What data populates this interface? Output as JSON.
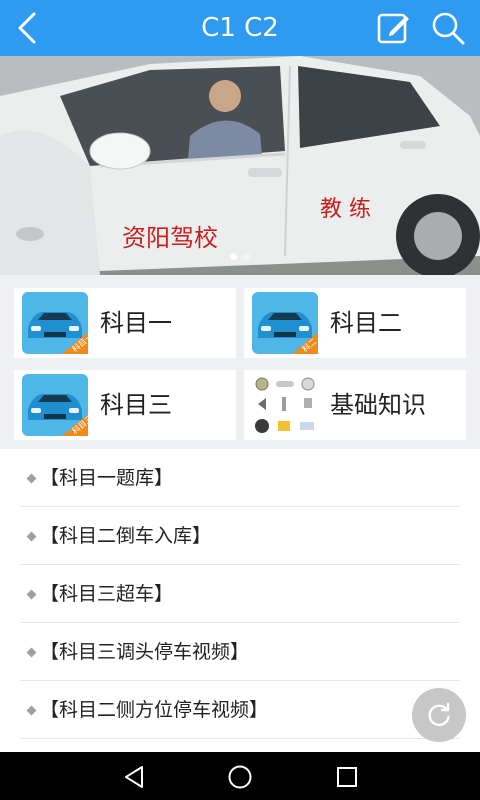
{
  "colors": {
    "accent": "#2f9bf0",
    "banner_text": "#c81e1e"
  },
  "header": {
    "title": "C1 C2",
    "icons": {
      "back": "chevron-left-icon",
      "edit": "edit-icon",
      "search": "search-icon"
    }
  },
  "banner": {
    "caption_school": "资阳驾校",
    "caption_coach": "教 练",
    "slide_indicator": {
      "current": 1,
      "total": 2
    }
  },
  "categories": [
    {
      "label": "科目一",
      "icon": "car-icon",
      "badge": "科目一"
    },
    {
      "label": "科目二",
      "icon": "car-icon",
      "badge": "科二"
    },
    {
      "label": "科目三",
      "icon": "car-icon",
      "badge": "科目三"
    },
    {
      "label": "基础知识",
      "icon": "car-parts-icon",
      "badge": ""
    }
  ],
  "articles": [
    "【科目一题库】",
    "【科目二倒车入库】",
    "【科目三超车】",
    "【科目三调头停车视频】",
    "【科目二侧方位停车视频】"
  ],
  "fab": {
    "icon": "refresh-icon"
  },
  "system_nav": {
    "icons": [
      "back-triangle-icon",
      "home-circle-icon",
      "recents-square-icon"
    ]
  }
}
